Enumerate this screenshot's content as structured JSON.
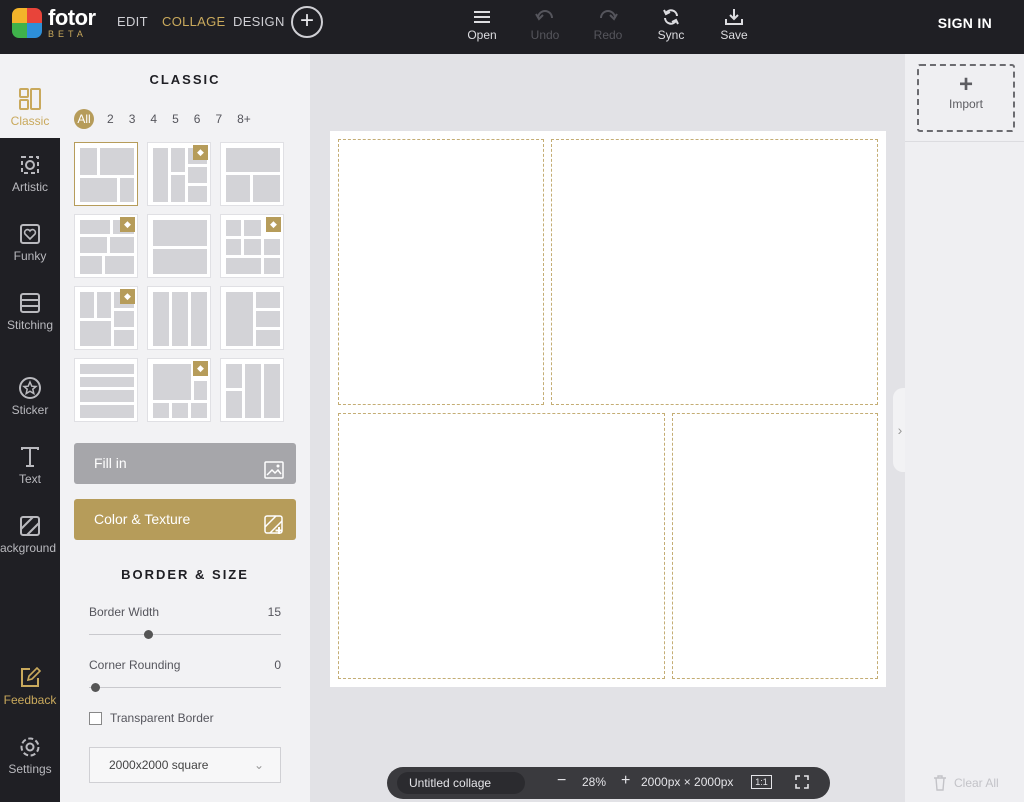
{
  "brand": {
    "name": "fotor",
    "beta": "BETA"
  },
  "nav": {
    "edit": "EDIT",
    "collage": "COLLAGE",
    "design": "DESIGN"
  },
  "toolbar": {
    "open": "Open",
    "undo": "Undo",
    "redo": "Redo",
    "sync": "Sync",
    "save": "Save"
  },
  "auth": {
    "signin": "SIGN IN"
  },
  "rail": {
    "classic": "Classic",
    "artistic": "Artistic",
    "funky": "Funky",
    "stitching": "Stitching",
    "sticker": "Sticker",
    "text": "Text",
    "background": "Background",
    "feedback": "Feedback",
    "settings": "Settings"
  },
  "panel": {
    "title": "CLASSIC",
    "filters": [
      "All",
      "2",
      "3",
      "4",
      "5",
      "6",
      "7",
      "8+"
    ],
    "fill_in": "Fill in",
    "color_texture": "Color & Texture",
    "border_title": "BORDER & SIZE",
    "border_width_label": "Border Width",
    "border_width_value": "15",
    "corner_label": "Corner Rounding",
    "corner_value": "0",
    "transparent_label": "Transparent Border",
    "size_value": "2000x2000 square"
  },
  "right": {
    "import": "Import",
    "clear_all": "Clear All"
  },
  "bottom": {
    "title": "Untitled collage",
    "zoom": "28%",
    "dimensions": "2000px × 2000px",
    "actual": "1:1"
  },
  "colors": {
    "accent": "#b69c5a",
    "dark": "#1f1f24"
  }
}
